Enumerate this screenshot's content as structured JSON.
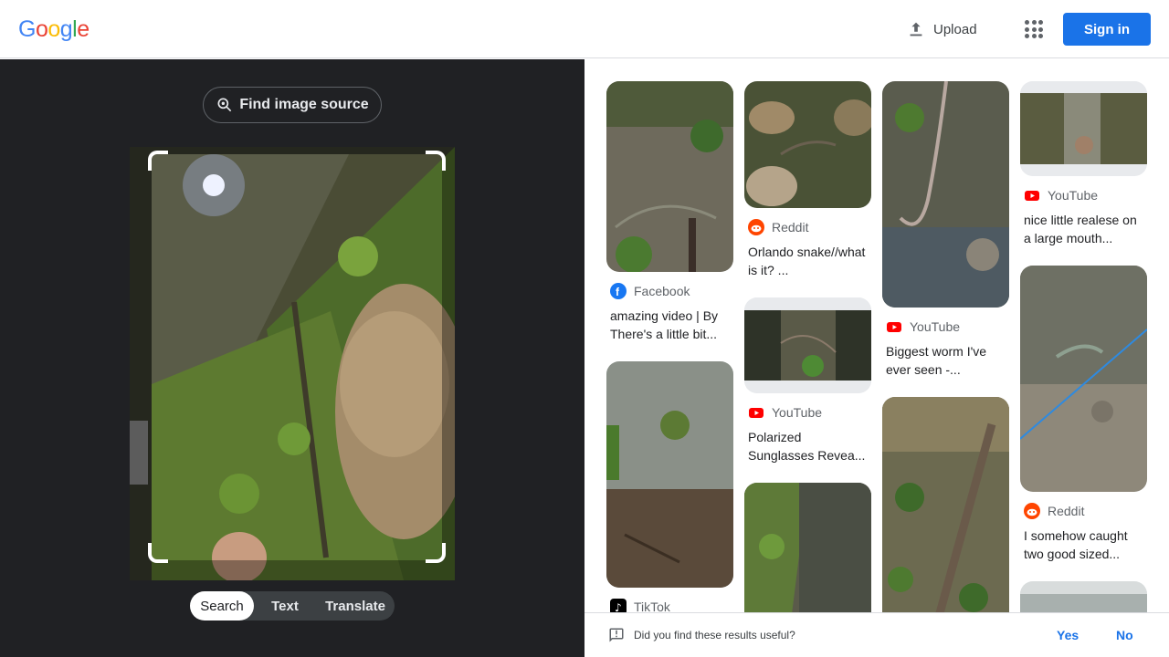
{
  "header": {
    "logo_text": "Google",
    "upload_label": "Upload",
    "apps_icon": "apps-grid-icon",
    "signin_label": "Sign in",
    "colors": {
      "accent": "#1a73e8"
    }
  },
  "lens": {
    "find_source_label": "Find image source",
    "tabs": [
      {
        "label": "Search",
        "active": true
      },
      {
        "label": "Text",
        "active": false
      },
      {
        "label": "Translate",
        "active": false
      }
    ]
  },
  "results": {
    "col1": [
      {
        "source": "Facebook",
        "title": "amazing video | By There's a little bit..."
      },
      {
        "source": "TikTok",
        "title": ""
      }
    ],
    "col2": [
      {
        "source": "Reddit",
        "title": "Orlando snake//what is it? ..."
      },
      {
        "source": "YouTube",
        "title": "Polarized Sunglasses Revea..."
      },
      {
        "source": "",
        "title": ""
      }
    ],
    "col3": [
      {
        "source": "YouTube",
        "title": "Biggest worm I've ever seen -..."
      },
      {
        "source": "",
        "title": ""
      }
    ],
    "col4": [
      {
        "source": "YouTube",
        "title": "nice little realese on a large mouth..."
      },
      {
        "source": "Reddit",
        "title": "I somehow caught two good sized..."
      }
    ]
  },
  "feedback": {
    "question": "Did you find these results useful?",
    "yes_label": "Yes",
    "no_label": "No"
  }
}
